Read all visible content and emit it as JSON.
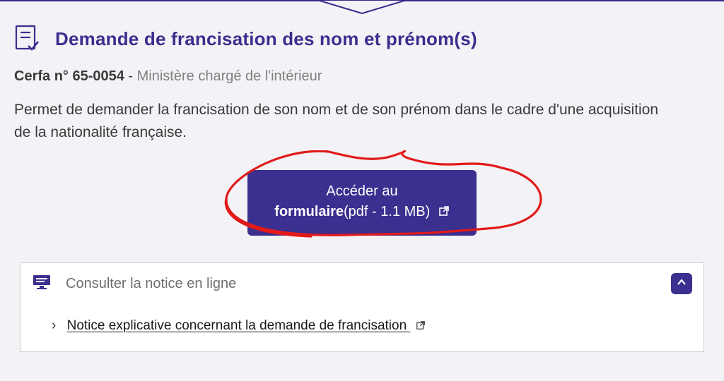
{
  "colors": {
    "accent": "#3b2f8f",
    "annotation": "#e21a1a"
  },
  "header": {
    "title": "Demande de francisation des nom et prénom(s)"
  },
  "cerfa": {
    "label": "Cerfa n° 65-0054",
    "separator": " - ",
    "source": "Ministère chargé de l'intérieur"
  },
  "description": "Permet de demander la francisation de son nom et de son prénom dans le cadre d'une acquisition de la nationalité française.",
  "button": {
    "line1": "Accéder au",
    "bold": "formulaire",
    "meta": "(pdf - 1.1 MB)"
  },
  "notice": {
    "header": "Consulter la notice en ligne",
    "link_text": "Notice explicative concernant la demande de francisation "
  }
}
